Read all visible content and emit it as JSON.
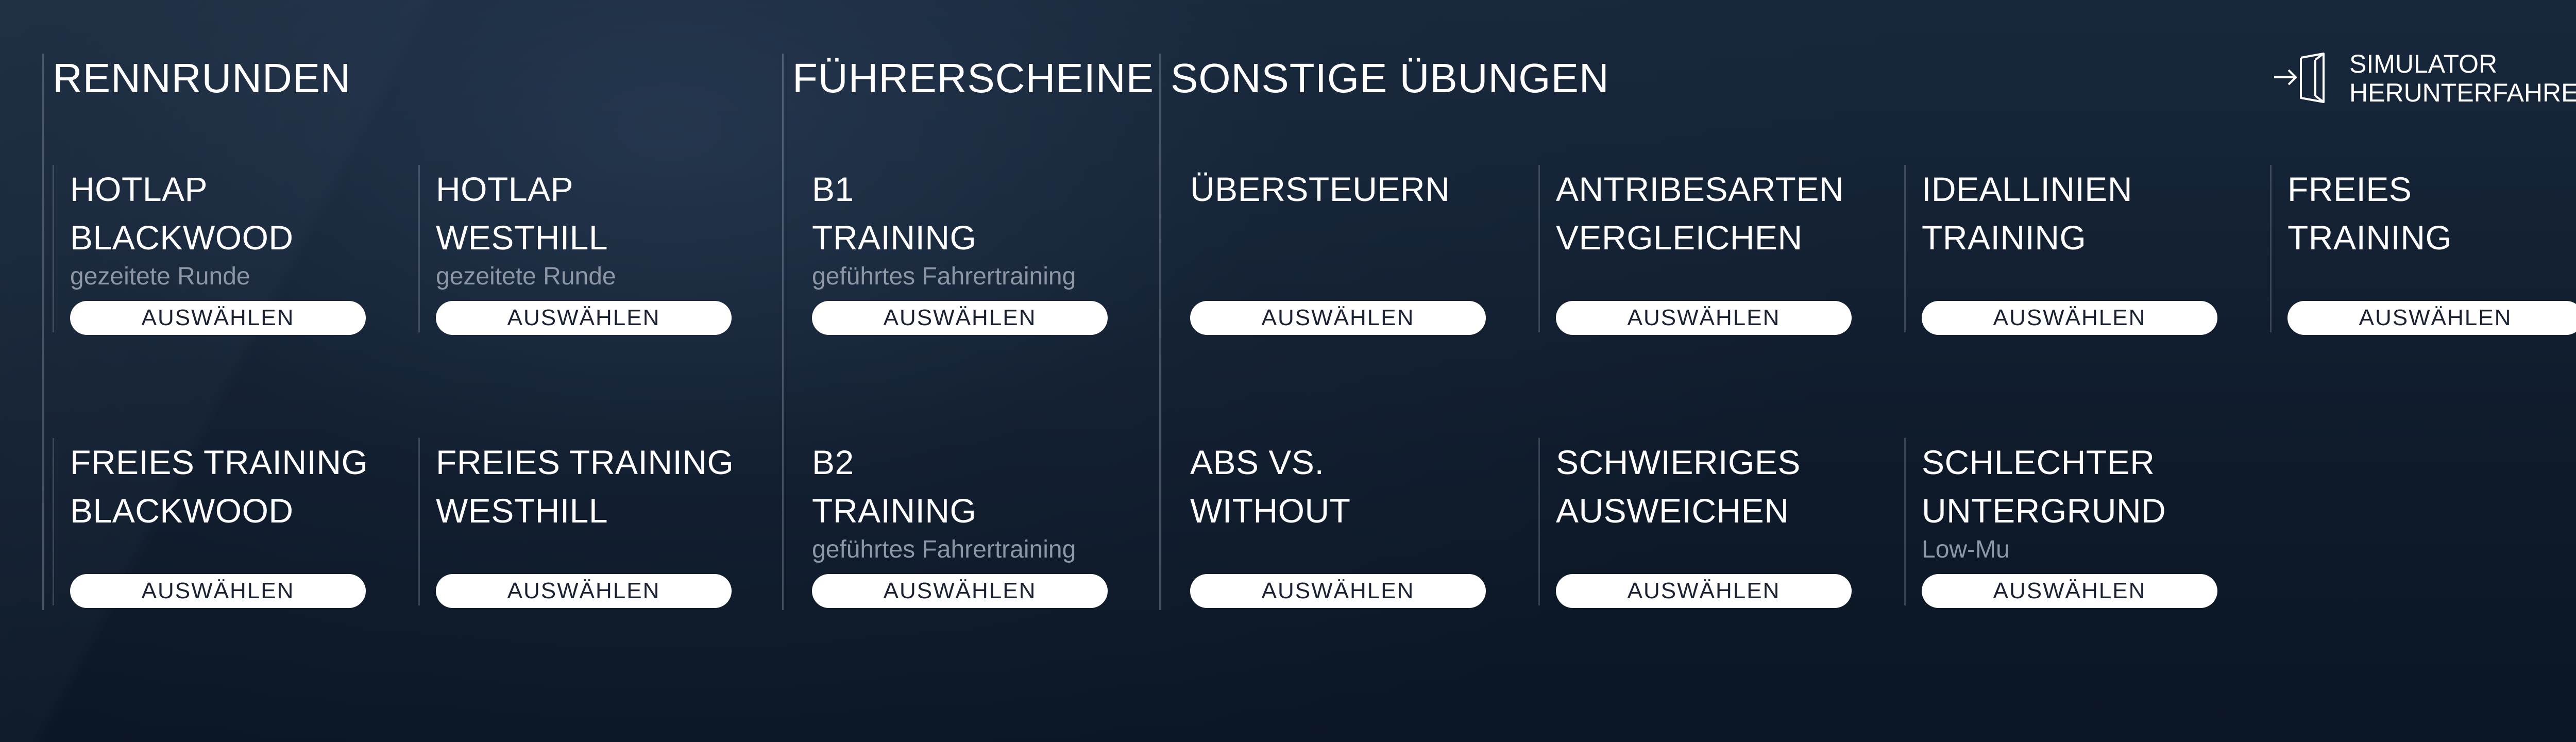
{
  "sections": {
    "rennrunden": "RENNRUNDEN",
    "fuehrerscheine": "FÜHRERSCHEINE",
    "sonstige": "SONSTIGE ÜBUNGEN"
  },
  "shutdown": {
    "line1": "SIMULATOR",
    "line2": "HERUNTERFAHREN",
    "icon": "door-exit-icon"
  },
  "button_label": "AUSWÄHLEN",
  "cards": [
    {
      "line1": "HOTLAP",
      "line2": "BLACKWOOD",
      "sub": "gezeitete Runde"
    },
    {
      "line1": "HOTLAP",
      "line2": "WESTHILL",
      "sub": "gezeitete Runde"
    },
    {
      "line1": "B1",
      "line2": "TRAINING",
      "sub": "geführtes Fahrertraining"
    },
    {
      "line1": "ÜBERSTEUERN",
      "line2": "",
      "sub": ""
    },
    {
      "line1": "ANTRIBESARTEN",
      "line2": "VERGLEICHEN",
      "sub": ""
    },
    {
      "line1": "IDEALLINIEN",
      "line2": "TRAINING",
      "sub": ""
    },
    {
      "line1": "FREIES",
      "line2": "TRAINING",
      "sub": ""
    },
    {
      "line1": "FREIES TRAINING",
      "line2": "BLACKWOOD",
      "sub": ""
    },
    {
      "line1": "FREIES TRAINING",
      "line2": "WESTHILL",
      "sub": ""
    },
    {
      "line1": "B2",
      "line2": "TRAINING",
      "sub": "geführtes Fahrertraining"
    },
    {
      "line1": "ABS VS.",
      "line2": "WITHOUT",
      "sub": ""
    },
    {
      "line1": "SCHWIERIGES",
      "line2": "AUSWEICHEN",
      "sub": ""
    },
    {
      "line1": "SCHLECHTER",
      "line2": "UNTERGRUND",
      "sub": "Low-Mu"
    }
  ]
}
